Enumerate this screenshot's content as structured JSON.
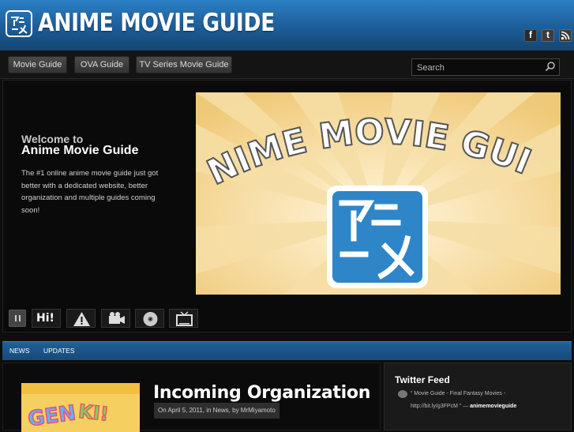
{
  "header": {
    "logo_text": "ANIME MOVIE GUIDE",
    "social": [
      "facebook-icon",
      "twitter-icon",
      "rss-icon"
    ]
  },
  "nav": {
    "items": [
      "Movie Guide",
      "OVA Guide",
      "TV Series Movie Guide"
    ],
    "search_placeholder": "Search"
  },
  "feature": {
    "welcome_sub": "Welcome to",
    "welcome_title": "Anime Movie Guide",
    "body": "The #1 online anime movie guide just got better with a dedicated website, better organization and multiple guides coming soon!",
    "banner_text": "ANIME MOVIE GUIDE",
    "thumbs": [
      "Hi!",
      "warning-icon",
      "camera-icon",
      "disc-icon",
      "tv-icon"
    ]
  },
  "subnav": {
    "items": [
      "NEWS",
      "UPDATES"
    ]
  },
  "post": {
    "title": "Incoming Organization",
    "meta": "On April 5, 2011, in News, by MrMiyamoto"
  },
  "sidebar": {
    "title": "Twitter Feed",
    "tweet_text": "“ Movie Guide - Final Fantasy Movies -",
    "tweet_link": "http://bit.ly/g3FPcM ” —",
    "tweet_author": "animemovieguide"
  },
  "colors": {
    "header_blue": "#1d5d98",
    "subnav_blue": "#1f5f98",
    "background": "#0d0d0d"
  }
}
